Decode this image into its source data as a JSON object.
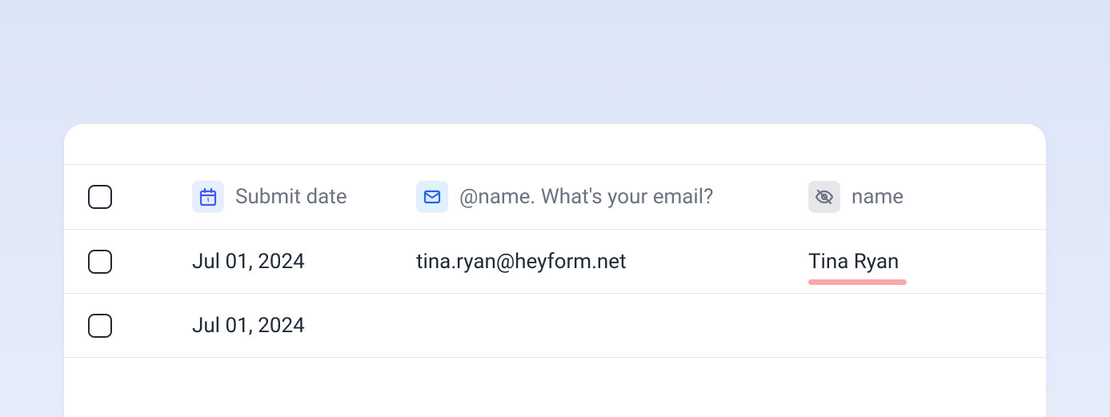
{
  "columns": {
    "submit_date": {
      "label": "Submit date",
      "icon": "calendar-icon"
    },
    "email": {
      "label": "@name. What's your email?",
      "icon": "mail-icon"
    },
    "name": {
      "label": "name",
      "icon": "hidden-icon"
    }
  },
  "rows": [
    {
      "date": "Jul 01, 2024",
      "email": "tina.ryan@heyform.net",
      "name": "Tina Ryan",
      "highlight_name": true
    },
    {
      "date": "Jul 01, 2024",
      "email": "",
      "name": ""
    }
  ],
  "colors": {
    "accent_blue": "#3b5bf7",
    "mail_blue": "#2563eb",
    "muted_gray": "#6b7280",
    "highlight": "#f9a8a8"
  }
}
